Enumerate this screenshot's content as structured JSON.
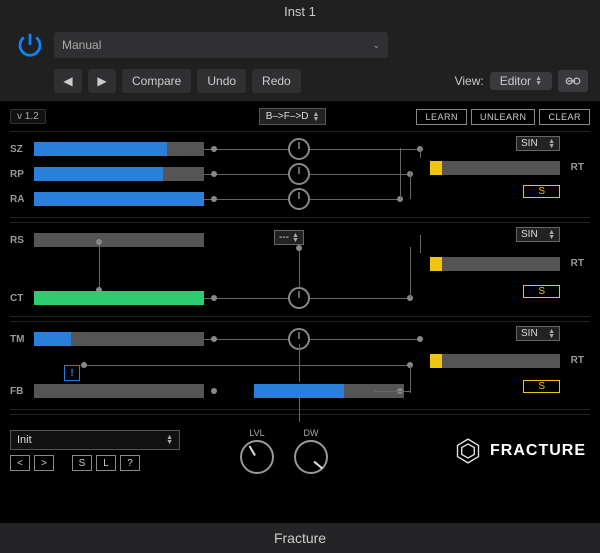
{
  "header": {
    "title": "Inst 1",
    "preset_mode": "Manual",
    "compare": "Compare",
    "undo": "Undo",
    "redo": "Redo",
    "view_label": "View:",
    "view_value": "Editor"
  },
  "plugin": {
    "version": "v 1.2",
    "route": "B–>F–>D",
    "learn": "LEARN",
    "unlearn": "UNLEARN",
    "clear": "CLEAR"
  },
  "sec1": {
    "rows": [
      {
        "label": "SZ",
        "fill": 78
      },
      {
        "label": "RP",
        "fill": 76
      },
      {
        "label": "RA",
        "fill": 100
      }
    ],
    "wave": "SIN",
    "rt": "RT",
    "s": "S"
  },
  "sec2": {
    "rows": [
      {
        "label": "RS",
        "fill": 0
      },
      {
        "label": "CT",
        "fill": 100
      }
    ],
    "mid_sel": "---",
    "wave": "SIN",
    "rt": "RT",
    "s": "S"
  },
  "sec3": {
    "rows": [
      {
        "label": "TM",
        "fill": 22
      },
      {
        "label": "FB",
        "fill": 0
      }
    ],
    "bang": "!",
    "wave": "SIN",
    "rt": "RT",
    "s": "S"
  },
  "bottom": {
    "preset": "Init",
    "prev": "<",
    "next": ">",
    "save": "S",
    "load": "L",
    "help": "?",
    "lvl": "LVL",
    "dw": "DW",
    "brand": "FRACTURE"
  },
  "footer": "Fracture"
}
